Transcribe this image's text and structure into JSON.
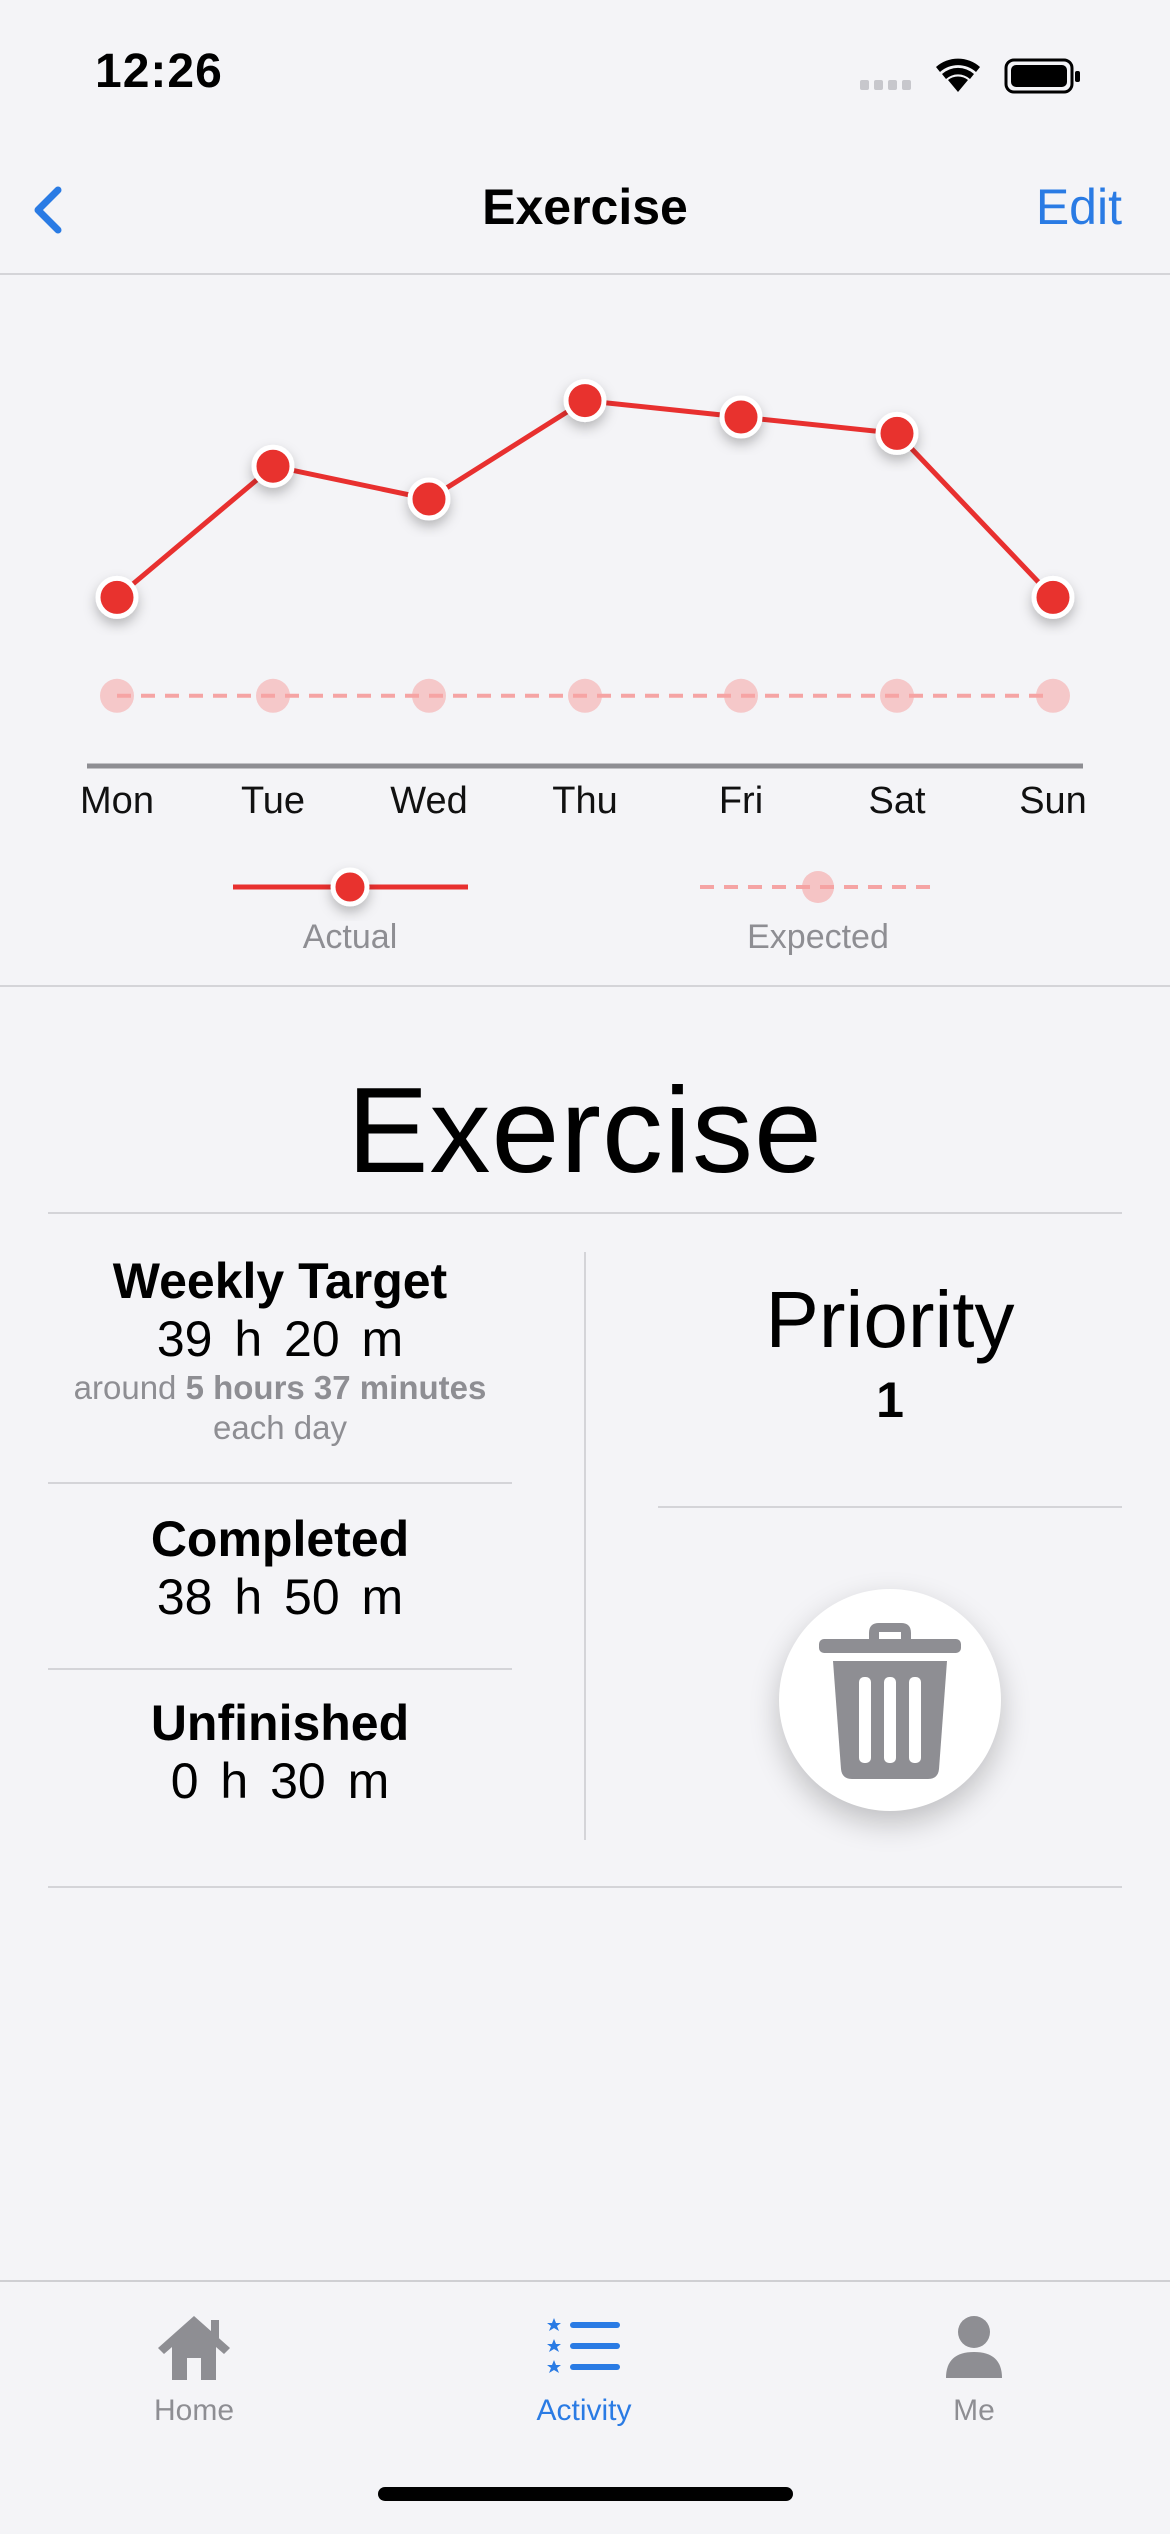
{
  "status_bar": {
    "time": "12:26"
  },
  "nav": {
    "title": "Exercise",
    "edit_label": "Edit"
  },
  "chart_data": {
    "type": "line",
    "categories": [
      "Mon",
      "Tue",
      "Wed",
      "Thu",
      "Fri",
      "Sat",
      "Sun"
    ],
    "series": [
      {
        "name": "Actual",
        "values": [
          5.2,
          6.0,
          5.8,
          6.4,
          6.3,
          6.2,
          5.2
        ]
      },
      {
        "name": "Expected",
        "values": [
          4.6,
          4.6,
          4.6,
          4.6,
          4.6,
          4.6,
          4.6
        ]
      }
    ],
    "ylim": [
      4.3,
      6.8
    ],
    "colors": {
      "actual": "#e8302f",
      "expected": "#f5a4a4"
    }
  },
  "main": {
    "title": "Exercise",
    "weekly_target": {
      "label": "Weekly Target",
      "value": "39 h  20 m",
      "sub_prefix": "around",
      "sub_bold": "5 hours 37 minutes",
      "sub_suffix": "each day"
    },
    "completed": {
      "label": "Completed",
      "value": "38 h  50 m"
    },
    "unfinished": {
      "label": "Unfinished",
      "value": "0 h  30 m"
    },
    "priority": {
      "label": "Priority",
      "value": "1"
    },
    "delete_icon": "trash-icon"
  },
  "tabs": [
    {
      "label": "Home",
      "icon": "house-icon",
      "active": false
    },
    {
      "label": "Activity",
      "icon": "list-icon",
      "active": true
    },
    {
      "label": "Me",
      "icon": "person-icon",
      "active": false
    }
  ],
  "colors": {
    "accent": "#2a7be4",
    "inactive": "#8e8e93",
    "background": "#f4f4f7"
  }
}
